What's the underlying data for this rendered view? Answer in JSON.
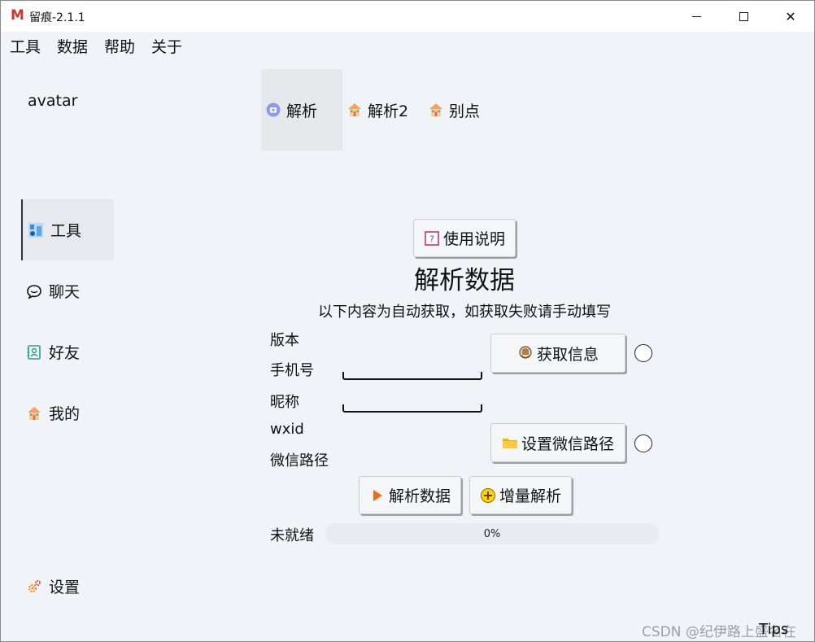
{
  "window": {
    "title": "留痕-2.1.1",
    "logo": "M",
    "min_icon": "minimize-icon",
    "max_icon": "maximize-icon",
    "close_symbol": "✕"
  },
  "menu": [
    "工具",
    "数据",
    "帮助",
    "关于"
  ],
  "sidebar": {
    "avatar": "avatar",
    "items": [
      {
        "label": "工具",
        "icon": "tools-icon"
      },
      {
        "label": "聊天",
        "icon": "chat-icon"
      },
      {
        "label": "好友",
        "icon": "contacts-icon"
      },
      {
        "label": "我的",
        "icon": "house-icon"
      },
      {
        "label": "设置",
        "icon": "gear-icon"
      }
    ]
  },
  "tabs": [
    {
      "label": "解析",
      "icon": "parse-icon"
    },
    {
      "label": "解析2",
      "icon": "house-icon"
    },
    {
      "label": "别点",
      "icon": "house-icon"
    }
  ],
  "main": {
    "help_button": "使用说明",
    "title": "解析数据",
    "subtitle": "以下内容为自动获取，如获取失败请手动填写",
    "labels": {
      "version": "版本",
      "phone": "手机号",
      "nickname": "昵称",
      "wxid": "wxid",
      "wechat_path": "微信路径"
    },
    "get_info_button": "获取信息",
    "set_path_button": "设置微信路径",
    "parse_button": "解析数据",
    "incremental_button": "增量解析",
    "status": "未就绪",
    "progress_text": "0%",
    "progress": 0
  },
  "footer": {
    "tips": "Tips",
    "watermark": "CSDN @纪伊路上盛名在"
  },
  "colors": {
    "background": "#f0f4f9",
    "accent_logo": "#d0342c",
    "active_nav": "#e6eaee"
  }
}
